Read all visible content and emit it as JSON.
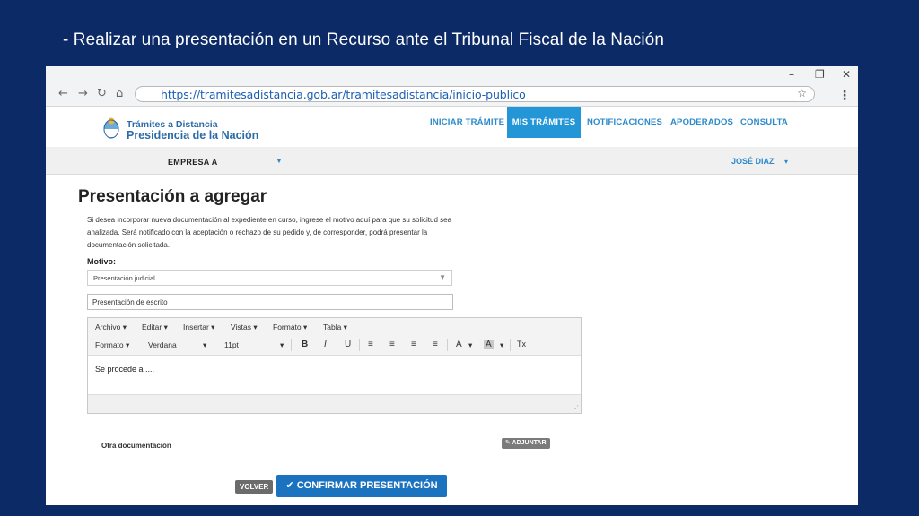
{
  "slide": {
    "title": "- Realizar una presentación en un Recurso ante el Tribunal Fiscal de la Nación"
  },
  "browser": {
    "url": "https://tramitesadistancia.gob.ar/tramitesadistancia/inicio-publico",
    "controls": {
      "minimize": "–",
      "restore": "❐",
      "close": "✕",
      "back": "←",
      "forward": "→",
      "reload": "↻",
      "home": "⌂",
      "star": "☆",
      "menu": "⋮"
    }
  },
  "site": {
    "logo_line1": "Trámites a Distancia",
    "logo_line2": "Presidencia de la Nación",
    "nav": [
      "INICIAR TRÁMITE",
      "MIS TRÁMITES",
      "NOTIFICACIONES",
      "APODERADOS",
      "CONSULTA"
    ],
    "active_nav": "MIS TRÁMITES"
  },
  "subbar": {
    "empresa": "EMPRESA  A",
    "user": "JOSÉ DIAZ"
  },
  "form": {
    "heading": "Presentación a agregar",
    "intro": "Si desea incorporar nueva documentación al expediente en curso, ingrese el motivo aquí para que su solicitud sea analizada. Será notificado con la aceptación o rechazo de su pedido y, de corresponder, podrá presentar la documentación solicitada.",
    "motivo_label": "Motivo:",
    "motivo_value": "Presentación judicial",
    "subject_value": "Presentación de escrito"
  },
  "editor": {
    "menus": [
      "Archivo ▾",
      "Editar ▾",
      "Insertar ▾",
      "Vistas ▾",
      "Formato ▾",
      "Tabla ▾"
    ],
    "format_label": "Formato ▾",
    "font_family": "Verdana",
    "font_size": "11pt",
    "body": "Se procede a ....",
    "buttons": {
      "bold": "B",
      "italic": "I",
      "underline": "U",
      "align_left": "≡",
      "align_center": "≡",
      "align_right": "≡",
      "justify": "≡",
      "text_color": "A",
      "bg_color": "A",
      "clear": "Tx"
    }
  },
  "attachments": {
    "label": "Otra documentación",
    "button": "✎ ADJUNTAR"
  },
  "actions": {
    "back": "VOLVER",
    "confirm": "✔ CONFIRMAR PRESENTACIÓN"
  }
}
